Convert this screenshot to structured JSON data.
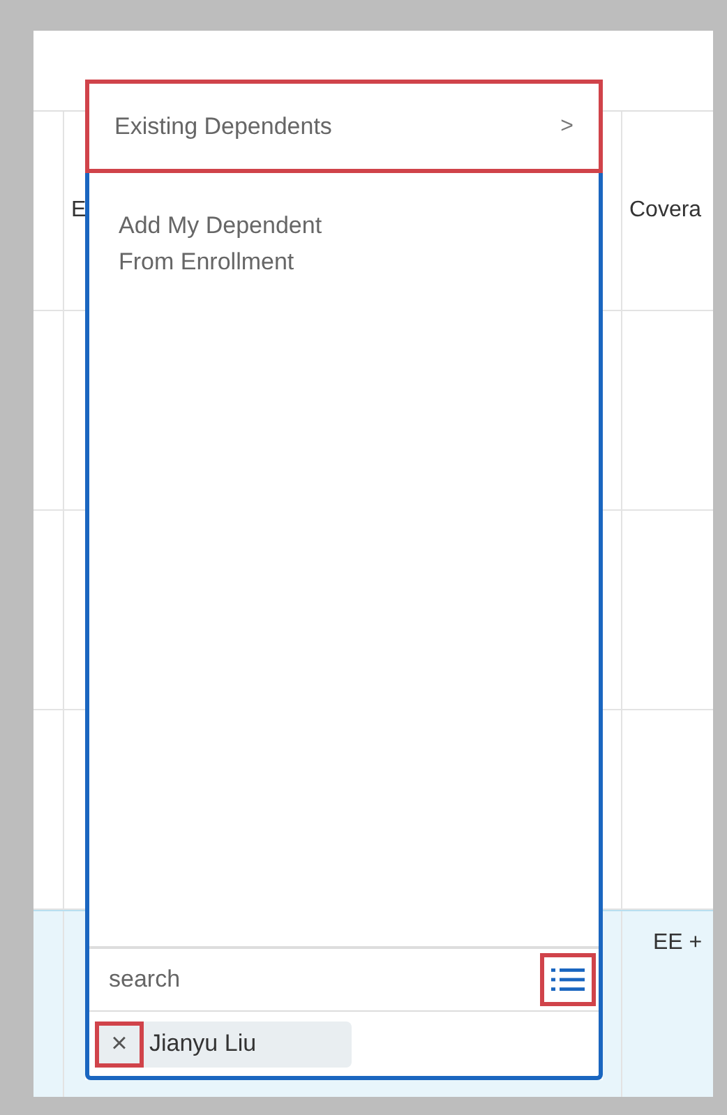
{
  "table": {
    "columns": [
      {
        "label": "E"
      },
      {
        "label": "Covera"
      }
    ],
    "rows": [
      {
        "selected": false
      },
      {
        "selected": false
      },
      {
        "selected": false
      },
      {
        "selected": true,
        "column_3": "EE +"
      }
    ]
  },
  "menu": {
    "items": [
      {
        "label": "Existing Dependents",
        "submenu": ">",
        "highlighted": true
      },
      {
        "label": "Add My Dependent\nFrom Enrollment",
        "highlighted": false
      }
    ],
    "search": {
      "placeholder": "search",
      "list_button_highlighted": true
    },
    "chips": [
      {
        "label": "Jianyu Liu",
        "remove": "×",
        "remove_highlighted": true
      }
    ]
  }
}
